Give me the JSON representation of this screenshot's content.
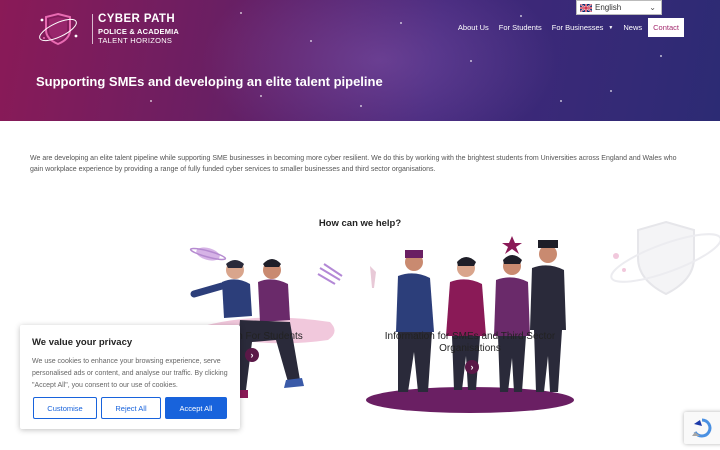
{
  "header": {
    "logo": {
      "line1": "CYBER PATH",
      "line2": "POLICE & ACADEMIA",
      "line3": "TALENT HORIZONS"
    },
    "nav": [
      {
        "label": "About Us"
      },
      {
        "label": "For Students"
      },
      {
        "label": "For Businesses",
        "has_dropdown": true
      },
      {
        "label": "News"
      },
      {
        "label": "Contact",
        "active": true
      }
    ],
    "language": {
      "selected": "English"
    }
  },
  "hero": {
    "title": "Supporting SMEs and developing an elite talent pipeline"
  },
  "main": {
    "intro": "We are developing an elite talent pipeline while supporting SME businesses in becoming more cyber resilient. We do this by working with the brightest students from Universities across England and Wales who gain workplace experience by providing a range of fully funded cyber services to smaller businesses and third sector organisations.",
    "help_title": "How can we help?",
    "cards": [
      {
        "label": "n For Students"
      },
      {
        "label": "Information for SMEs and Third Sector Organisations"
      }
    ]
  },
  "cookie_banner": {
    "title": "We value your privacy",
    "text": "We use cookies to enhance your browsing experience, serve personalised ads or content, and analyse our traffic. By clicking \"Accept All\", you consent to our use of cookies.",
    "customise_label": "Customise",
    "reject_label": "Reject All",
    "accept_label": "Accept All"
  },
  "colors": {
    "brand_magenta": "#8a1a57",
    "brand_purple": "#43277a",
    "accent_blue": "#1863dc",
    "arrow_dark": "#5a1847"
  }
}
